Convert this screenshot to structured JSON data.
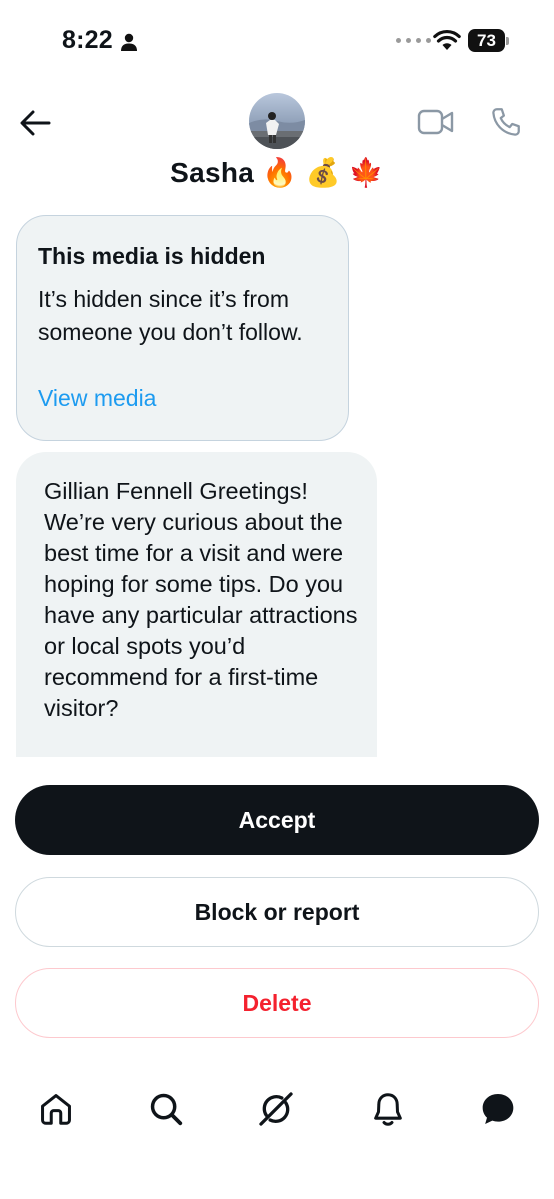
{
  "status_bar": {
    "time": "8:22",
    "battery": "73"
  },
  "header": {
    "contact_name": "Sasha 🔥 💰 🍁"
  },
  "hidden_media": {
    "title": "This media is hidden",
    "body": "It’s hidden since it’s from someone you don’t follow.",
    "link_label": "View media"
  },
  "message": {
    "text": "Gillian Fennell Greetings! We’re very curious about the best time for a visit and were hoping for some tips. Do you have any particular attractions or local spots you’d recommend for a first-time visitor?"
  },
  "actions": {
    "accept_label": "Accept",
    "block_label": "Block or report",
    "delete_label": "Delete"
  },
  "nav": {
    "items": [
      "home-icon",
      "search-icon",
      "grok-icon",
      "bell-icon",
      "messages-icon"
    ]
  },
  "colors": {
    "accent_link": "#1d9bf0",
    "danger": "#f4212e",
    "primary_button": "#0f1419",
    "bubble_bg": "#eff3f4"
  }
}
